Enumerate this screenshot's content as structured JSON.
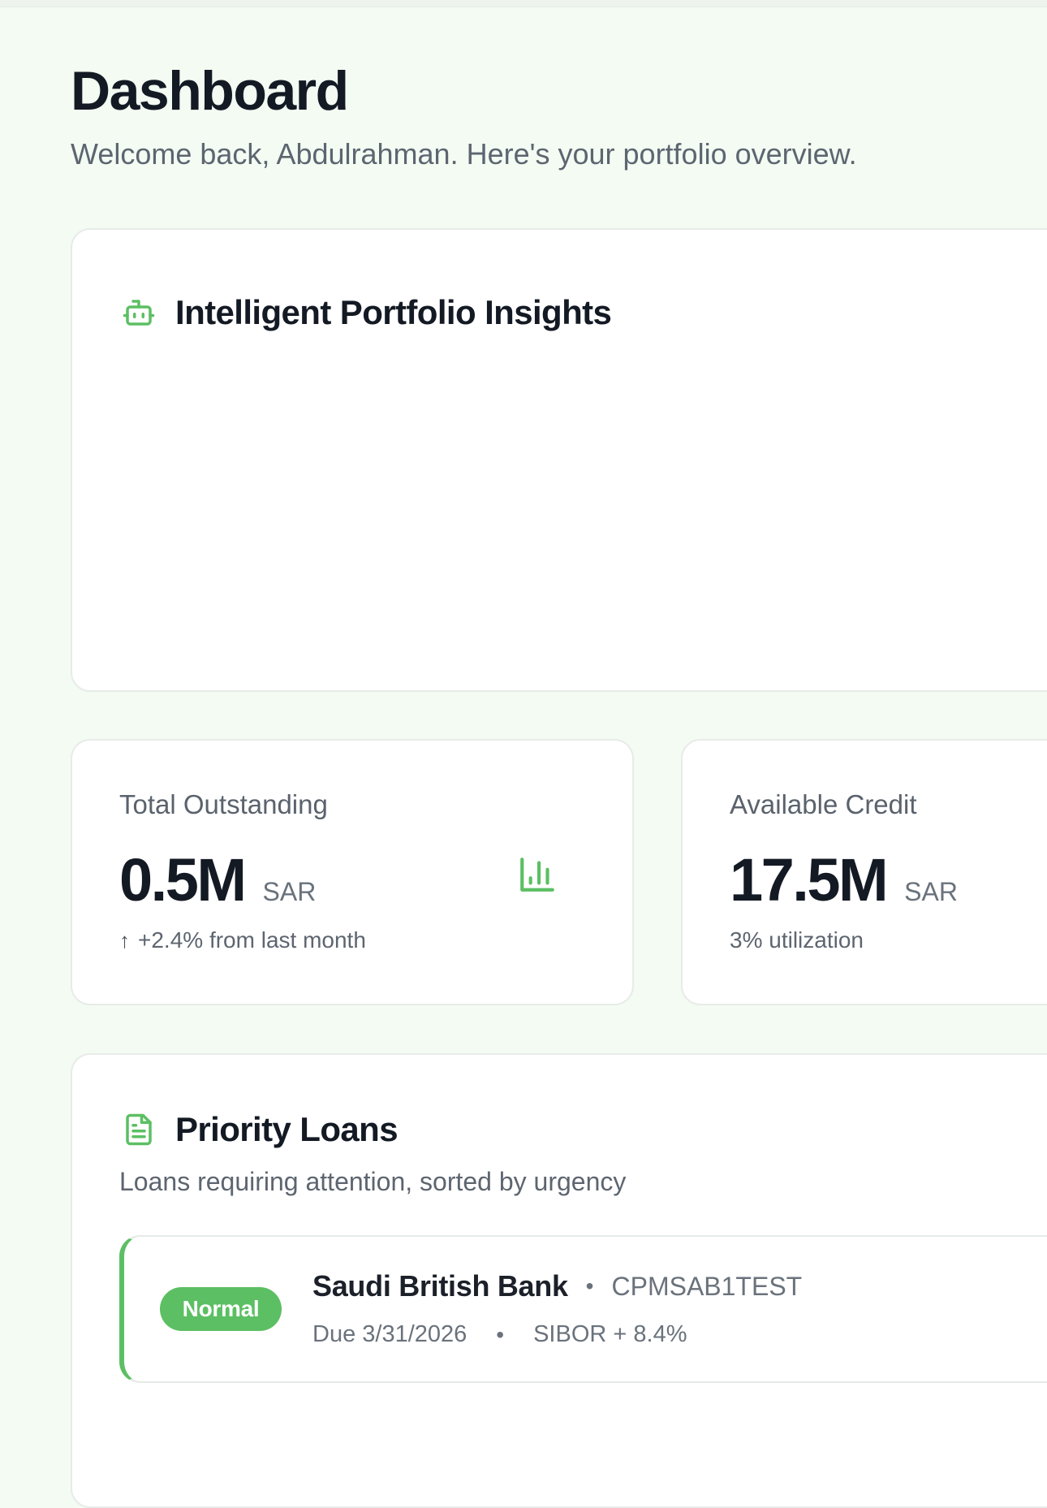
{
  "header": {
    "title": "Dashboard",
    "subtitle": "Welcome back, Abdulrahman. Here's your portfolio overview."
  },
  "insights": {
    "title": "Intelligent Portfolio Insights",
    "icon": "robot-icon"
  },
  "kpis": {
    "total_outstanding": {
      "label": "Total Outstanding",
      "value": "0.5M",
      "unit": "SAR",
      "change_arrow": "↑",
      "change": "+2.4% from last month",
      "icon": "bar-chart-icon"
    },
    "available_credit": {
      "label": "Available Credit",
      "value": "17.5M",
      "unit": "SAR",
      "note": "3% utilization"
    }
  },
  "priority_loans": {
    "title": "Priority Loans",
    "subtitle": "Loans requiring attention, sorted by urgency",
    "icon": "document-icon",
    "items": [
      {
        "status": "Normal",
        "bank": "Saudi British Bank",
        "separator": "•",
        "code": "CPMSAB1TEST",
        "due": "Due 3/31/2026",
        "rate": "SIBOR + 8.4%"
      }
    ]
  },
  "colors": {
    "accent": "#5cbf63",
    "background": "#f3fbf3",
    "text_primary": "#141a24",
    "text_muted": "#5d6570"
  }
}
